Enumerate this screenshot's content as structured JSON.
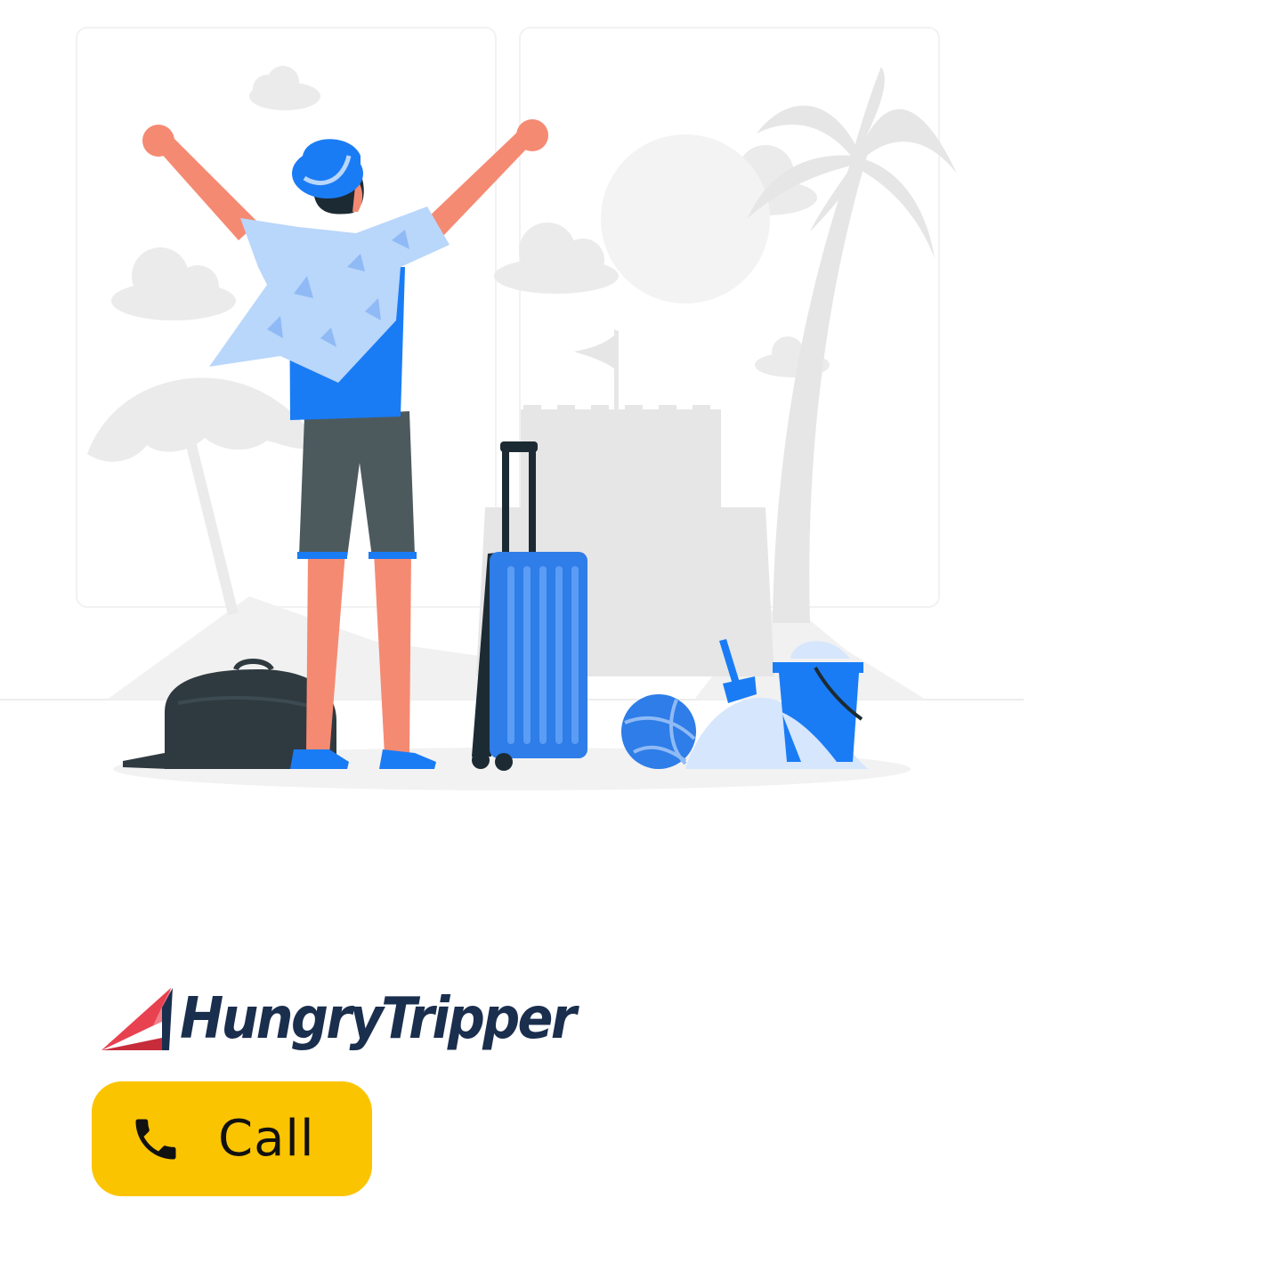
{
  "brand": {
    "name": "HungryTripper",
    "logo_icon": "paper-plane-icon",
    "colors": {
      "text": "#1a2e4d",
      "mark_red": "#e8414f",
      "mark_pink": "#f27f89",
      "mark_navy": "#1a2e4d"
    }
  },
  "hero": {
    "illustration": "traveler-beach-illustration",
    "colors": {
      "accent_blue": "#1a7cf5",
      "background_grey": "#ebebeb"
    }
  },
  "call_button": {
    "label": "Call",
    "icon": "phone-icon",
    "color": "#fbc400"
  }
}
